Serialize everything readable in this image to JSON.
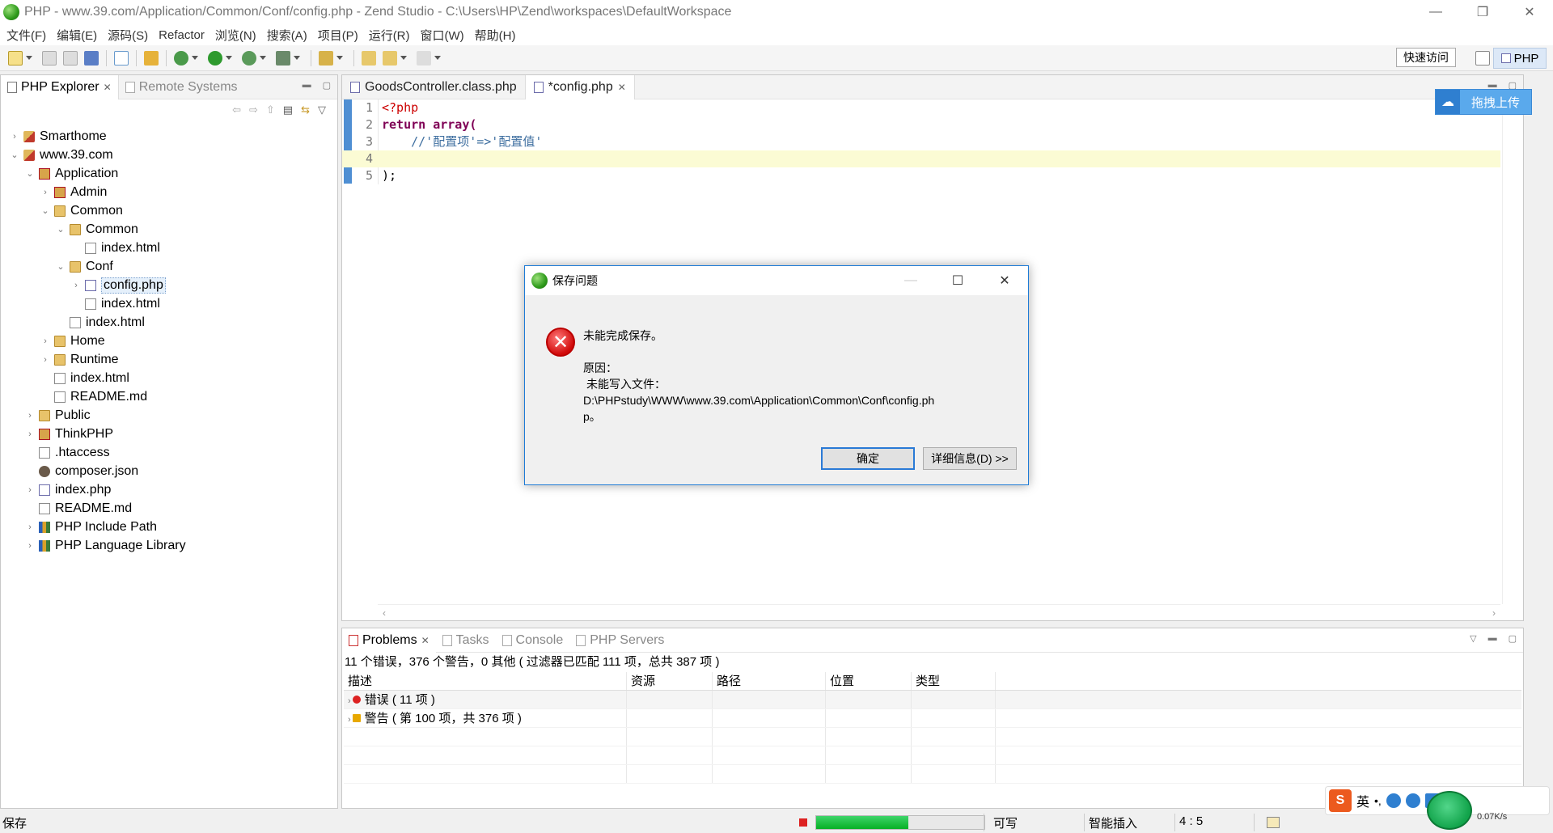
{
  "window": {
    "title": "PHP  -  www.39.com/Application/Common/Conf/config.php  -  Zend Studio  -  C:\\Users\\HP\\Zend\\workspaces\\DefaultWorkspace",
    "min_label": "—",
    "restore_label": "❐",
    "close_label": "✕"
  },
  "menu": [
    "文件(F)",
    "编辑(E)",
    "源码(S)",
    "Refactor",
    "浏览(N)",
    "搜索(A)",
    "项目(P)",
    "运行(R)",
    "窗口(W)",
    "帮助(H)"
  ],
  "toolbar": {
    "quick_access": "快速访问",
    "perspective": "PHP"
  },
  "explorer": {
    "tab_active": "PHP Explorer",
    "tab_inactive": "Remote Systems",
    "tree": [
      {
        "label": "Smarthome",
        "icon": "project-icon"
      },
      {
        "label": "www.39.com",
        "icon": "project-icon"
      },
      {
        "label": "Application",
        "icon": "package-icon"
      },
      {
        "label": "Admin",
        "icon": "package-icon"
      },
      {
        "label": "Common",
        "icon": "folder-icon"
      },
      {
        "label": "Common",
        "icon": "folder-icon"
      },
      {
        "label": "index.html",
        "icon": "file-icon"
      },
      {
        "label": "Conf",
        "icon": "folder-icon"
      },
      {
        "label": "config.php",
        "icon": "php-file-icon"
      },
      {
        "label": "index.html",
        "icon": "file-icon"
      },
      {
        "label": "index.html",
        "icon": "file-icon"
      },
      {
        "label": "Home",
        "icon": "folder-icon"
      },
      {
        "label": "Runtime",
        "icon": "folder-icon"
      },
      {
        "label": "index.html",
        "icon": "file-icon"
      },
      {
        "label": "README.md",
        "icon": "file-icon"
      },
      {
        "label": "Public",
        "icon": "folder-icon"
      },
      {
        "label": "ThinkPHP",
        "icon": "package-icon"
      },
      {
        "label": ".htaccess",
        "icon": "file-icon"
      },
      {
        "label": "composer.json",
        "icon": "json-icon"
      },
      {
        "label": "index.php",
        "icon": "php-file-icon"
      },
      {
        "label": "README.md",
        "icon": "file-icon"
      },
      {
        "label": "PHP Include Path",
        "icon": "library-icon"
      },
      {
        "label": "PHP Language Library",
        "icon": "library-icon"
      }
    ]
  },
  "editor": {
    "tabs": [
      "GoodsController.class.php",
      "*config.php"
    ],
    "lines": [
      {
        "n": "1",
        "text": "<?php"
      },
      {
        "n": "2",
        "text": "return array("
      },
      {
        "n": "3",
        "text": "    //'配置项'=>'配置值'"
      },
      {
        "n": "4",
        "text": ""
      },
      {
        "n": "5",
        "text": ");"
      }
    ]
  },
  "problems": {
    "tabs": [
      "Problems",
      "Tasks",
      "Console",
      "PHP Servers"
    ],
    "summary": "11 个错误，376 个警告，0 其他 ( 过滤器已匹配 111 项，总共 387 项 )",
    "columns": [
      "描述",
      "资源",
      "路径",
      "位置",
      "类型"
    ],
    "rows": [
      {
        "label": "错误 ( 11 项 )",
        "severity": "error"
      },
      {
        "label": "警告 ( 第 100 项，共 376 项 )",
        "severity": "warning"
      }
    ]
  },
  "dialog": {
    "title": "保存问题",
    "heading": "未能完成保存。",
    "reason_label": "原因：",
    "reason_detail": "未能写入文件：",
    "path_line1": "D:\\PHPstudy\\WWW\\www.39.com\\Application\\Common\\Conf\\config.ph",
    "path_line2": "p。",
    "ok_button": "确定",
    "details_button": "详细信息(D) >>"
  },
  "upload_widget": {
    "label": "拖拽上传"
  },
  "statusbar": {
    "left_text": "保存",
    "progress": 0.55,
    "writable": "可写",
    "insert_mode": "智能插入",
    "cursor_pos": "4 : 5"
  },
  "ime": {
    "logo": "S",
    "mode": "英",
    "speed": "0.07K/s"
  },
  "colors": {
    "accent": "#1e7bd6",
    "progress_green": "#06b025",
    "error_red": "#d10a0a"
  }
}
